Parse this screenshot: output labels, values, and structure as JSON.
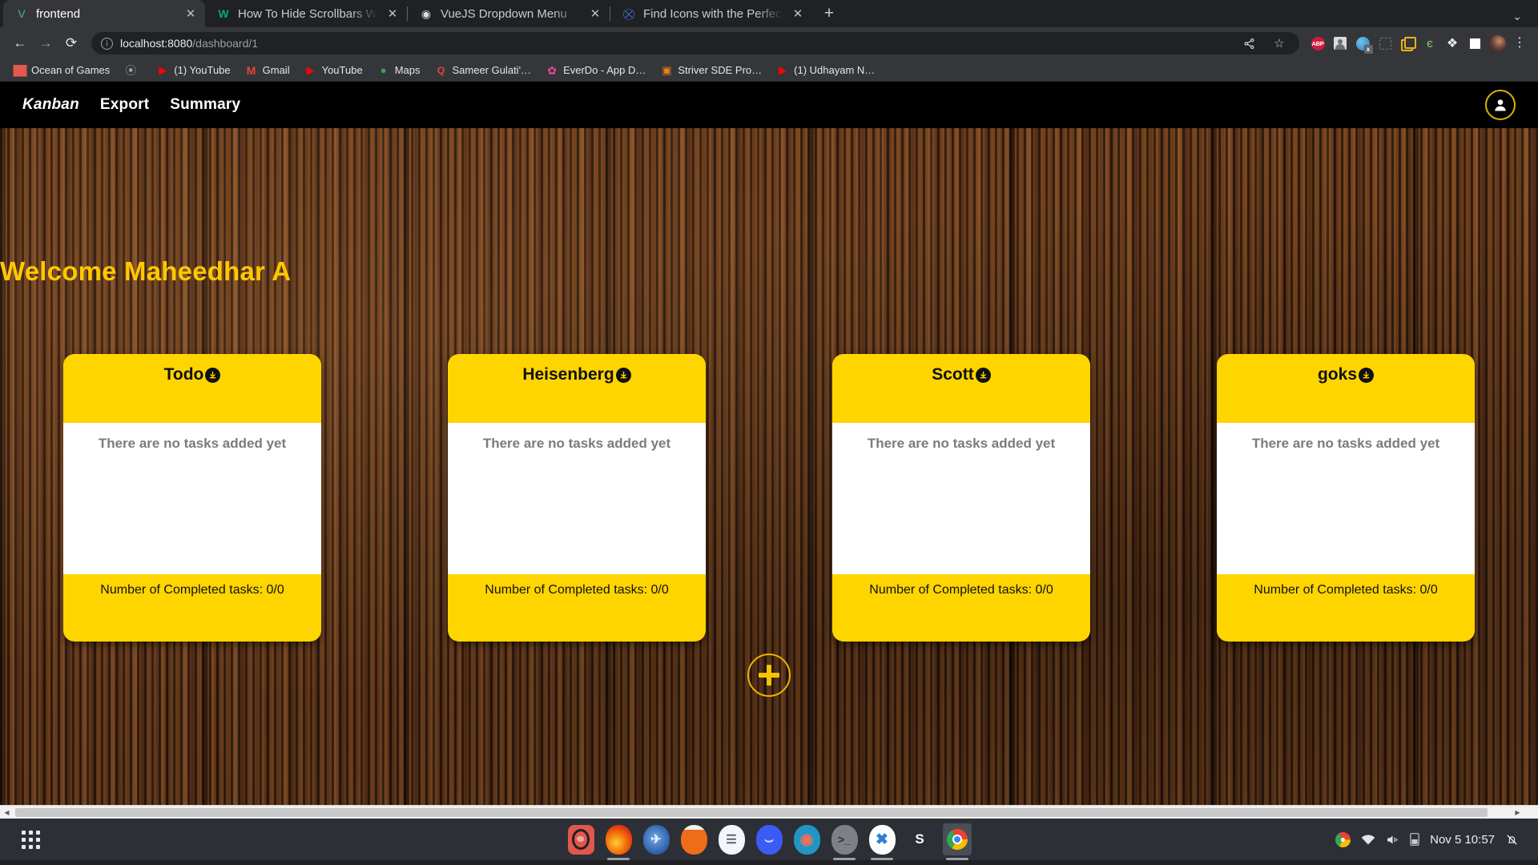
{
  "browser": {
    "tabs": [
      {
        "title": "frontend",
        "favicon": "vue-logo-icon",
        "active": true
      },
      {
        "title": "How To Hide Scrollbars W",
        "favicon": "w3schools-icon",
        "active": false
      },
      {
        "title": "VueJS Dropdown Menu",
        "favicon": "codepen-icon",
        "active": false
      },
      {
        "title": "Find Icons with the Perfec",
        "favicon": "flaticon-icon",
        "active": false
      }
    ],
    "new_tab_label": "+",
    "window_chevron": "⌄",
    "nav": {
      "back": "←",
      "forward": "→",
      "reload": "⟳"
    },
    "omnibox": {
      "info_icon": "i",
      "url_host": "localhost:8080",
      "url_path": "/dashboard/1",
      "share_icon": "share-icon",
      "bookmark_icon": "☆"
    },
    "extensions": [
      {
        "name": "adblock-plus-icon",
        "label": "ABP"
      },
      {
        "name": "screenshot-person-icon",
        "label": ""
      },
      {
        "name": "globe-translate-icon",
        "label": ""
      },
      {
        "name": "dashed-capture-icon",
        "label": ""
      },
      {
        "name": "window-resizer-icon",
        "label": ""
      },
      {
        "name": "swirl-extension-icon",
        "label": "є"
      },
      {
        "name": "puzzle-extensions-icon",
        "label": "❖"
      },
      {
        "name": "white-square-icon",
        "label": ""
      }
    ],
    "profile_icon": "profile-avatar",
    "menu_icon": "⋮",
    "bookmarks": [
      {
        "label": "Ocean of Games",
        "icon": "🎮",
        "color": "#e05a4f"
      },
      {
        "label": "",
        "icon": "S",
        "color": "#9aa0a6"
      },
      {
        "label": "(1) YouTube",
        "icon": "▶",
        "color": "#ff0000"
      },
      {
        "label": "Gmail",
        "icon": "M",
        "color": "#ea4335"
      },
      {
        "label": "YouTube",
        "icon": "▶",
        "color": "#ff0000"
      },
      {
        "label": "Maps",
        "icon": "📍",
        "color": "#34a853"
      },
      {
        "label": "Sameer Gulati'…",
        "icon": "Q",
        "color": "#e8453c"
      },
      {
        "label": "EverDo - App D…",
        "icon": "✿",
        "color": "#ec4899"
      },
      {
        "label": "Striver SDE Pro…",
        "icon": "▣",
        "color": "#f0801a"
      },
      {
        "label": "(1) Udhayam N…",
        "icon": "▶",
        "color": "#ff0000"
      }
    ]
  },
  "app": {
    "nav": {
      "brand": "Kanban",
      "links": [
        "Export",
        "Summary"
      ],
      "account_icon": "user-avatar-icon"
    },
    "welcome": "Welcome Maheedhar A",
    "empty_message": "There are no tasks added yet",
    "count_prefix": "Number of Completed tasks: ",
    "add_button_label": "+",
    "accent_yellow": "#ffd500",
    "accent_gold": "#ffc800",
    "lists": [
      {
        "title": "Todo",
        "menu_icon": "download-circle-icon",
        "empty": "There are no tasks added yet",
        "completed": "Number of Completed tasks: 0/0"
      },
      {
        "title": "Heisenberg",
        "menu_icon": "download-circle-icon",
        "empty": "There are no tasks added yet",
        "completed": "Number of Completed tasks: 0/0"
      },
      {
        "title": "Scott",
        "menu_icon": "download-circle-icon",
        "empty": "There are no tasks added yet",
        "completed": "Number of Completed tasks: 0/0"
      },
      {
        "title": "goks",
        "menu_icon": "download-circle-icon",
        "empty": "There are no tasks added yet",
        "completed": "Number of Completed tasks: 0/0"
      }
    ]
  },
  "taskbar": {
    "show_apps_label": "show-applications",
    "apps": [
      {
        "name": "app-launcher-red",
        "glyph": "◑",
        "bg": "#e0574b",
        "running": false
      },
      {
        "name": "firefox",
        "glyph": "🦊",
        "bg": "#f2750a",
        "running": true
      },
      {
        "name": "thunderbird",
        "glyph": "✉",
        "bg": "#2b5ea7",
        "running": false
      },
      {
        "name": "app-orange",
        "glyph": "",
        "bg": "#ef6c1a",
        "running": false
      },
      {
        "name": "document-writer",
        "glyph": "☰",
        "bg": "#f4f6fb",
        "running": false
      },
      {
        "name": "app-blue",
        "glyph": "⌣",
        "bg": "#3b5bf5",
        "running": false
      },
      {
        "name": "ubuntu-software",
        "glyph": "◎",
        "bg": "#2196c4",
        "running": false
      },
      {
        "name": "terminal",
        "glyph": ">_",
        "bg": "#7d8187",
        "running": true
      },
      {
        "name": "vscode",
        "glyph": "✖",
        "bg": "#ffffff",
        "running": true
      },
      {
        "name": "slack",
        "glyph": "S",
        "bg": "#2b2f36",
        "running": false
      },
      {
        "name": "google-chrome",
        "glyph": "",
        "bg": "#ffffff",
        "running": true
      }
    ],
    "tray": {
      "chrome_icon": "chrome-tray-icon",
      "wifi_icon": "wifi-icon",
      "volume_icon": "volume-icon",
      "battery_icon": "battery-icon",
      "clock": "Nov 5  10:57",
      "notification_icon": "notifications-off-icon"
    }
  }
}
